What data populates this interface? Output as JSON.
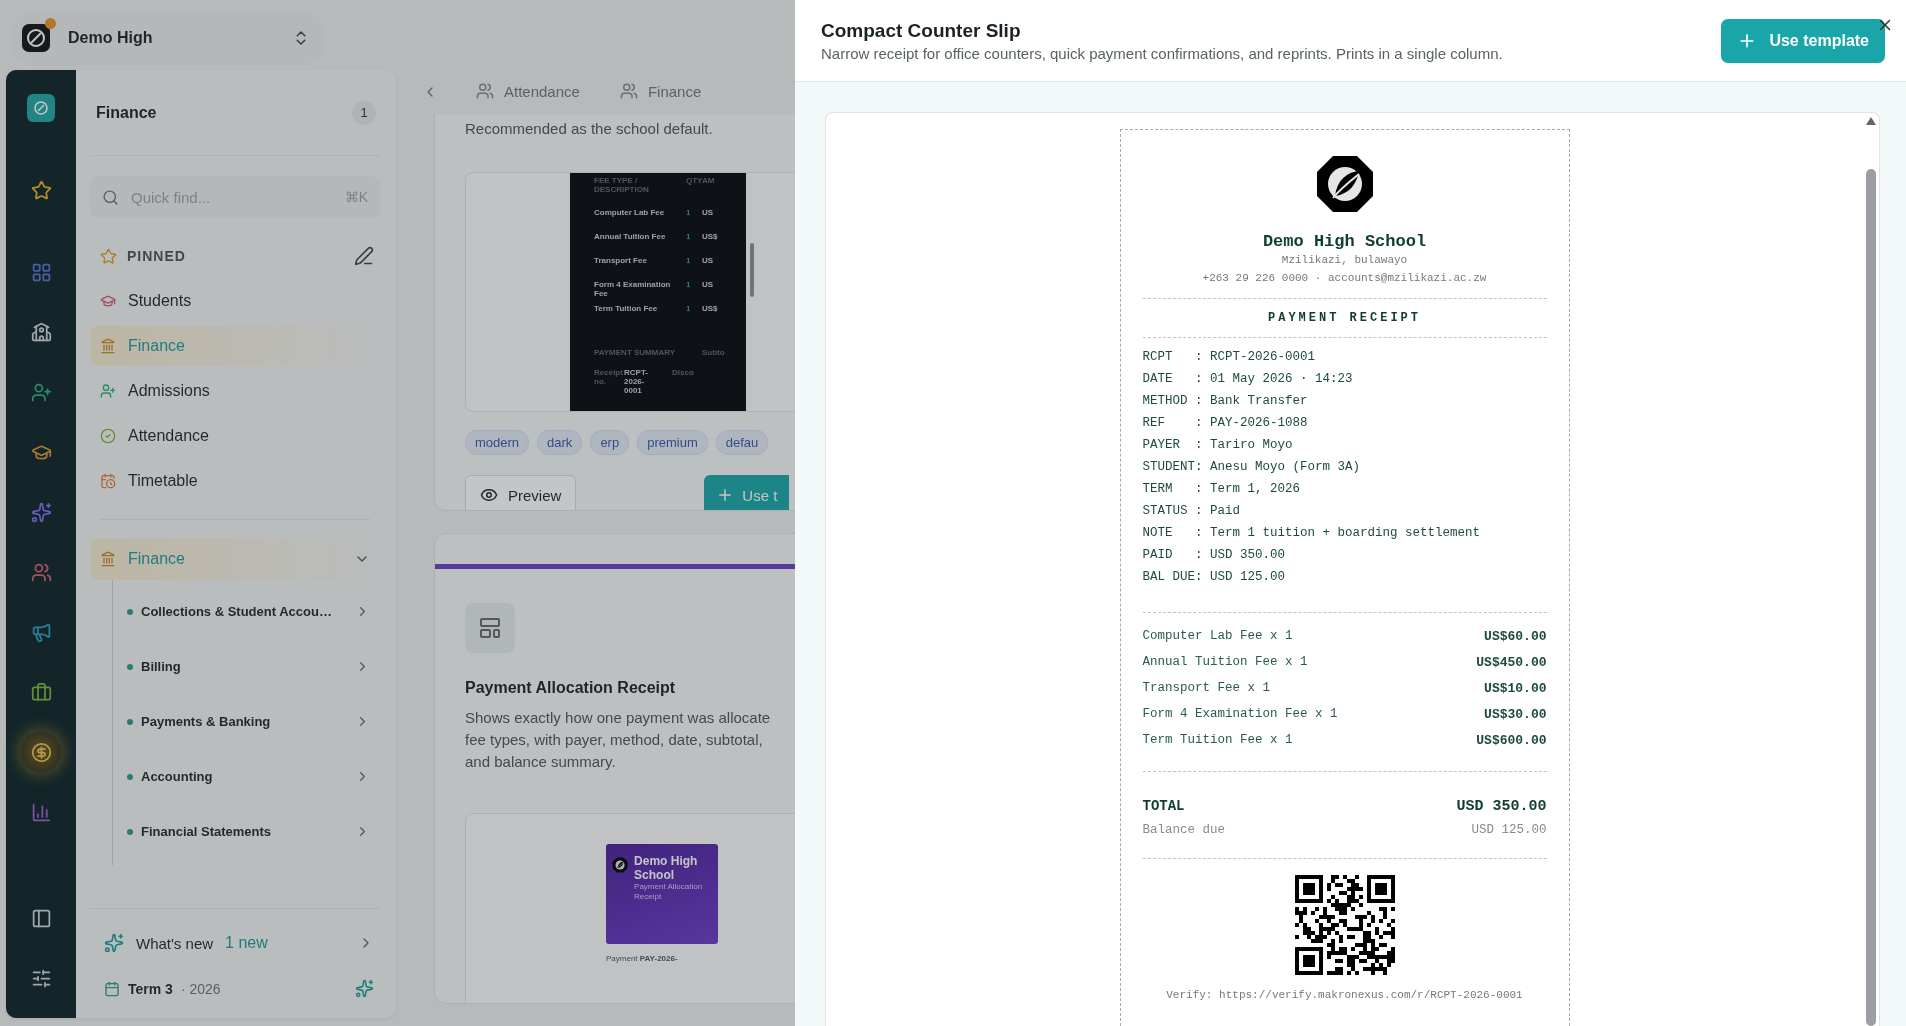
{
  "workspace": {
    "name": "Demo High",
    "notification": true
  },
  "rail": {
    "items": [
      {
        "selected": false
      },
      {
        "selected": false
      },
      {
        "selected": false
      },
      {
        "selected": false
      },
      {
        "selected": false
      },
      {
        "selected": false
      },
      {
        "selected": false
      },
      {
        "selected": false
      },
      {
        "selected": false
      },
      {
        "selected": true
      },
      {
        "selected": false
      }
    ]
  },
  "sidebar": {
    "title": "Finance",
    "badge": "1",
    "search": {
      "placeholder": "Quick find...",
      "shortcut": "⌘K"
    },
    "pinned": {
      "label": "PINNED",
      "items": [
        {
          "label": "Students",
          "selected": false
        },
        {
          "label": "Finance",
          "selected": true
        },
        {
          "label": "Admissions",
          "selected": false
        },
        {
          "label": "Attendance",
          "selected": false
        },
        {
          "label": "Timetable",
          "selected": false
        }
      ]
    },
    "group": {
      "label": "Finance",
      "expanded": true,
      "children": [
        {
          "label": "Collections & Student Accou…"
        },
        {
          "label": "Billing"
        },
        {
          "label": "Payments & Banking"
        },
        {
          "label": "Accounting"
        },
        {
          "label": "Financial Statements"
        }
      ]
    },
    "whats_new": {
      "label": "What's new",
      "count": "1 new"
    },
    "term": {
      "label": "Term 3",
      "separator": "·",
      "year": "2026"
    }
  },
  "content": {
    "tabs": [
      {
        "label": "Attendance",
        "selected": false
      },
      {
        "label": "Finance",
        "selected": false
      }
    ],
    "card1": {
      "description": "Recommended as the school default.",
      "preview": {
        "header": [
          "FEE TYPE / DESCRIPTION",
          "QTY",
          "AM"
        ],
        "rows": [
          [
            "Computer Lab Fee",
            "1",
            "US"
          ],
          [
            "Annual Tuition Fee",
            "1",
            "US$"
          ],
          [
            "Transport Fee",
            "1",
            "US"
          ],
          [
            "Form 4 Examination Fee",
            "1",
            "US"
          ],
          [
            "Term Tuition Fee",
            "1",
            "US$"
          ]
        ],
        "summary": "PAYMENT SUMMARY",
        "summary_right": "Subto",
        "receipt_label": "Receipt no.",
        "receipt_no": "RCPT-2026-0001",
        "discount": "Disco"
      },
      "tags": [
        "modern",
        "dark",
        "erp",
        "premium",
        "defau"
      ],
      "preview_button": "Preview",
      "use_button": "Use t"
    },
    "card2": {
      "title": "Payment Allocation Receipt",
      "description_lines": [
        "Shows exactly how one payment was allocate",
        "fee types, with payer, method, date, subtotal,",
        "and balance summary."
      ],
      "preview": {
        "school": "Demo High School",
        "doc": "Payment Allocation Receipt",
        "payment_label": "Payment",
        "payment_ref": "PAY-2026-"
      }
    }
  },
  "drawer": {
    "title": "Compact Counter Slip",
    "subtitle": "Narrow receipt for office counters, quick payment confirmations, and reprints. Prints in a single column.",
    "use_button": "Use template",
    "receipt": {
      "school": "Demo High School",
      "address": "Mzilikazi, bulawayo",
      "contact": "+263 29 226 0000 · accounts@mzilikazi.ac.zw",
      "heading": "PAYMENT RECEIPT",
      "fields": [
        {
          "label": "RCPT",
          "sep": ":",
          "value": "RCPT-2026-0001"
        },
        {
          "label": "DATE",
          "sep": ":",
          "value": "01 May 2026 · 14:23"
        },
        {
          "label": "METHOD",
          "sep": ":",
          "value": "Bank Transfer"
        },
        {
          "label": "REF",
          "sep": ":",
          "value": "PAY-2026-1088"
        },
        {
          "label": "PAYER",
          "sep": ":",
          "value": "Tariro Moyo"
        },
        {
          "label": "STUDENT",
          "sep": ":",
          "value": "Anesu Moyo (Form 3A)"
        },
        {
          "label": "TERM",
          "sep": ":",
          "value": "Term 1, 2026"
        },
        {
          "label": "STATUS",
          "sep": ":",
          "value": "Paid"
        },
        {
          "label": "NOTE",
          "sep": ":",
          "value": "Term 1 tuition + boarding settlement"
        },
        {
          "label": "PAID",
          "sep": ":",
          "value": "USD 350.00"
        },
        {
          "label": "BAL DUE",
          "sep": ":",
          "value": "USD 125.00"
        }
      ],
      "items": [
        {
          "name": "Computer Lab Fee x 1",
          "amount": "US$60.00"
        },
        {
          "name": "Annual Tuition Fee x 1",
          "amount": "US$450.00"
        },
        {
          "name": "Transport Fee x 1",
          "amount": "US$10.00"
        },
        {
          "name": "Form 4 Examination Fee x 1",
          "amount": "US$30.00"
        },
        {
          "name": "Term Tuition Fee x 1",
          "amount": "US$600.00"
        }
      ],
      "total_label": "TOTAL",
      "total": "USD 350.00",
      "balance_label": "Balance due",
      "balance": "USD 125.00",
      "verify": "Verify: https://verify.makronexus.com/r/RCPT-2026-0001"
    }
  }
}
